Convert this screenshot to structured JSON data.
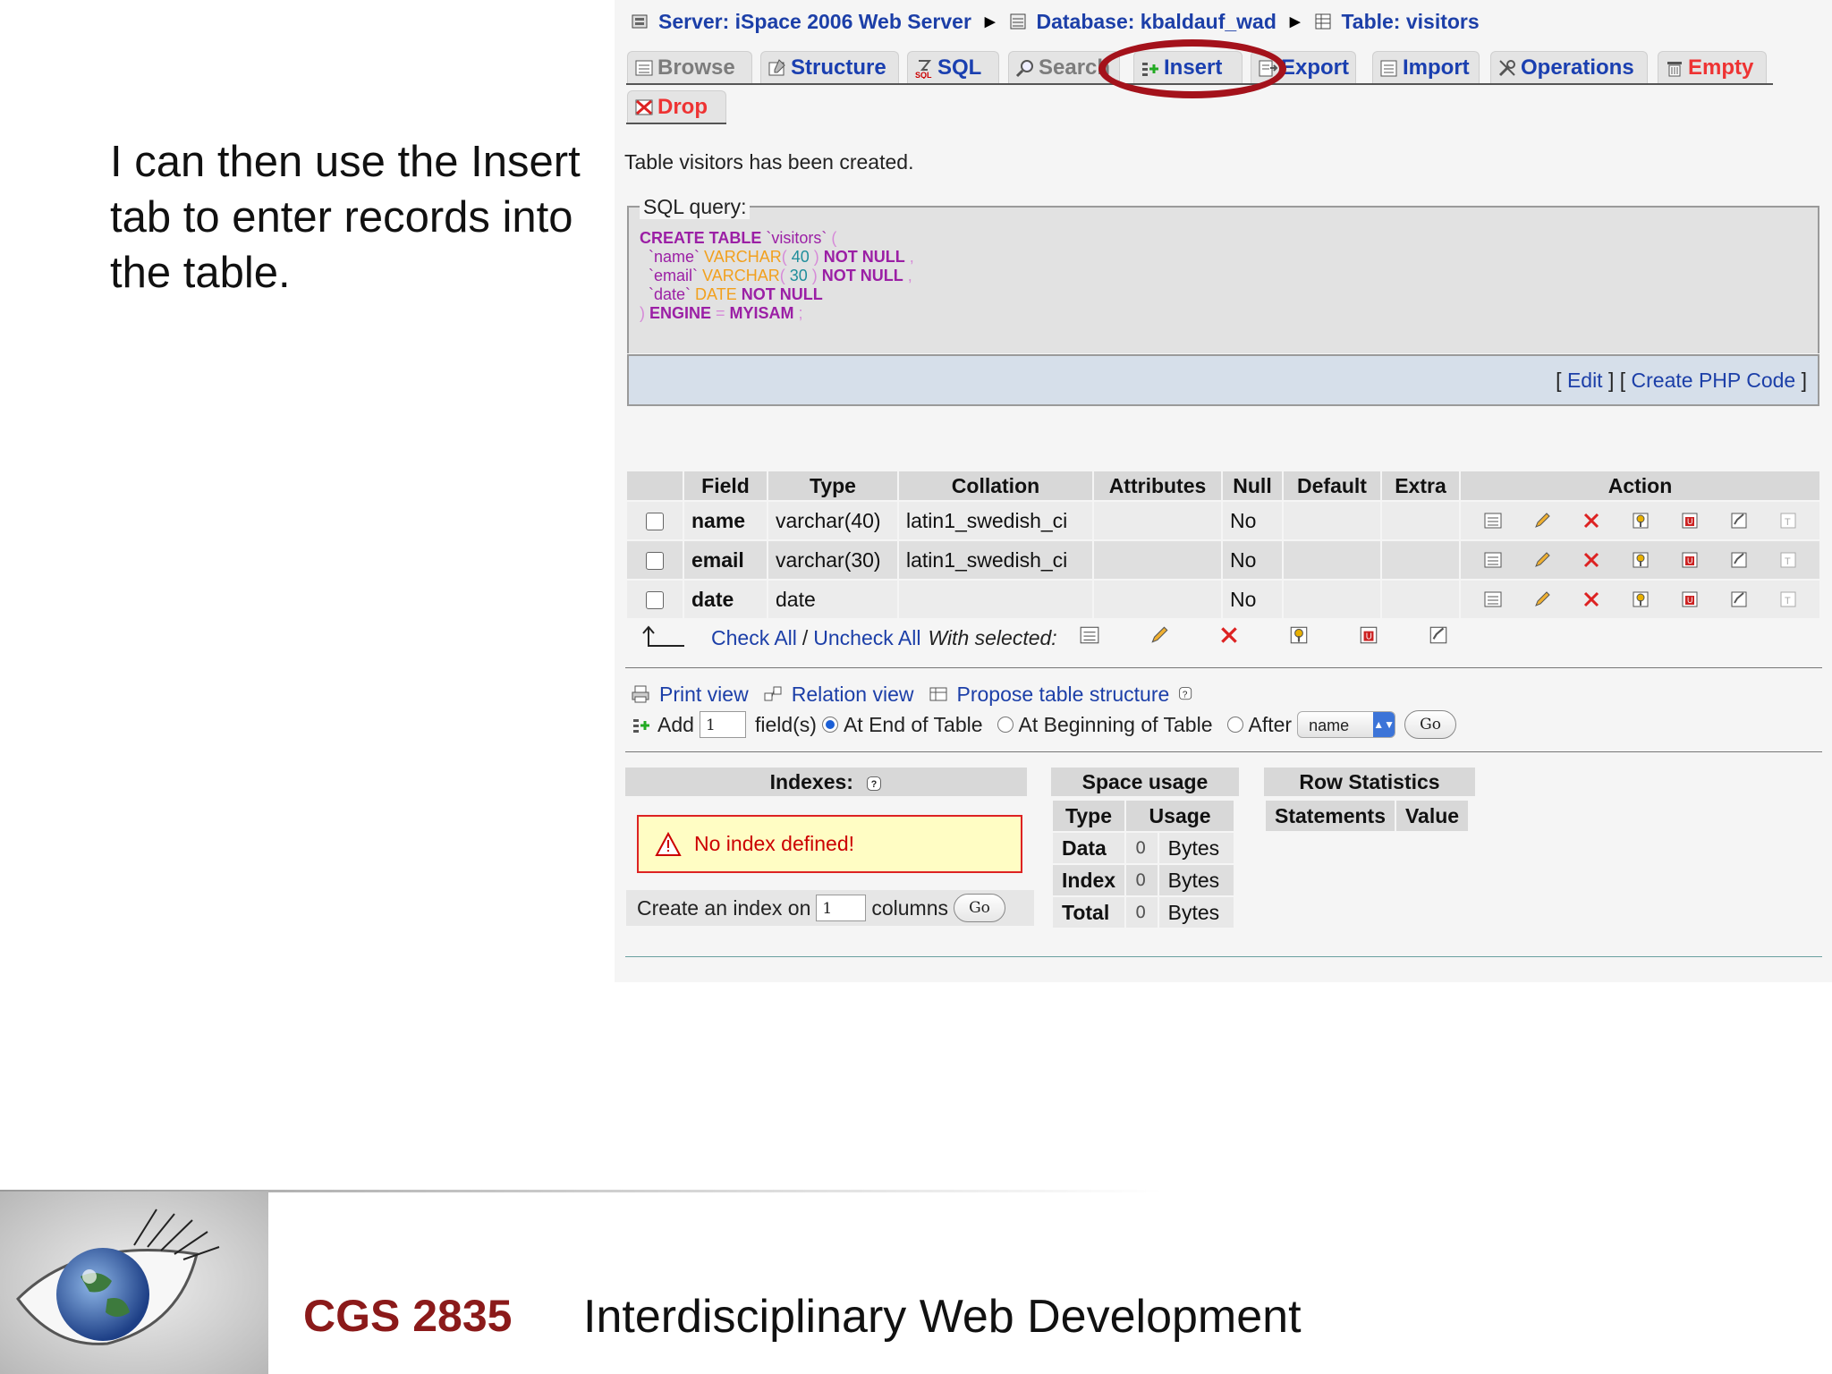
{
  "slide": {
    "caption": "I can then use the Insert tab to enter records into the table.",
    "course_code": "CGS 2835",
    "course_name": "Interdisciplinary Web Development"
  },
  "breadcrumb": {
    "server": "Server: iSpace 2006 Web Server",
    "database": "Database: kbaldauf_wad",
    "table": "Table: visitors"
  },
  "tabs": [
    {
      "label": "Browse",
      "icon": "browse-icon"
    },
    {
      "label": "Structure",
      "icon": "structure-icon"
    },
    {
      "label": "SQL",
      "icon": "sql-icon"
    },
    {
      "label": "Search",
      "icon": "search-icon"
    },
    {
      "label": "Insert",
      "icon": "insert-icon"
    },
    {
      "label": "Export",
      "icon": "export-icon"
    },
    {
      "label": "Import",
      "icon": "import-icon"
    },
    {
      "label": "Operations",
      "icon": "operations-icon"
    },
    {
      "label": "Empty",
      "icon": "empty-icon"
    },
    {
      "label": "Drop",
      "icon": "drop-icon"
    }
  ],
  "message": "Table visitors has been created.",
  "sql": {
    "legend": "SQL query:",
    "lines": [
      {
        "kw1": "CREATE TABLE",
        "nm": " `visitors` ",
        "pu": "("
      },
      {
        "nm": "`name` ",
        "ty": "VARCHAR",
        "pu1": "( ",
        "nu": "40",
        "pu2": " ) ",
        "kw": "NOT NULL",
        "pu3": " ,"
      },
      {
        "nm": "`email` ",
        "ty": "VARCHAR",
        "pu1": "( ",
        "nu": "30",
        "pu2": " ) ",
        "kw": "NOT NULL",
        "pu3": " ,"
      },
      {
        "nm": "`date` ",
        "ty": "DATE ",
        "kw": "NOT NULL"
      },
      {
        "pu": ") ",
        "kw1": "ENGINE",
        "pu2": " = ",
        "kw2": "MYISAM",
        "pu3": " ;"
      }
    ],
    "edit_link": "Edit",
    "php_link": "Create PHP Code"
  },
  "structure": {
    "headers": [
      "Field",
      "Type",
      "Collation",
      "Attributes",
      "Null",
      "Default",
      "Extra",
      "Action"
    ],
    "rows": [
      {
        "field": "name",
        "type": "varchar(40)",
        "collation": "latin1_swedish_ci",
        "attributes": "",
        "null": "No",
        "default": "",
        "extra": ""
      },
      {
        "field": "email",
        "type": "varchar(30)",
        "collation": "latin1_swedish_ci",
        "attributes": "",
        "null": "No",
        "default": "",
        "extra": ""
      },
      {
        "field": "date",
        "type": "date",
        "collation": "",
        "attributes": "",
        "null": "No",
        "default": "",
        "extra": ""
      }
    ],
    "check_all": "Check All",
    "separator": "/",
    "uncheck_all": "Uncheck All",
    "with_selected": "With selected:"
  },
  "links": {
    "print_view": "Print view",
    "relation_view": "Relation view",
    "propose": "Propose table structure"
  },
  "add_fields": {
    "add_label": "Add",
    "count": "1",
    "fields_label": "field(s)",
    "at_end": "At End of Table",
    "at_beginning": "At Beginning of Table",
    "after": "After",
    "after_select": "name",
    "go": "Go"
  },
  "indexes": {
    "title": "Indexes:",
    "no_index": "No index defined!",
    "create_label": "Create an index on",
    "count": "1",
    "columns_label": "columns",
    "go": "Go"
  },
  "space_usage": {
    "title": "Space usage",
    "headers": [
      "Type",
      "Usage"
    ],
    "rows": [
      {
        "type": "Data",
        "value": "0",
        "unit": "Bytes"
      },
      {
        "type": "Index",
        "value": "0",
        "unit": "Bytes"
      },
      {
        "type": "Total",
        "value": "0",
        "unit": "Bytes"
      }
    ]
  },
  "row_statistics": {
    "title": "Row Statistics",
    "headers": [
      "Statements",
      "Value"
    ]
  },
  "colors": {
    "link": "#1c3fa8",
    "highlight_circle": "#a4121b",
    "course_code": "#8b1a1a"
  }
}
